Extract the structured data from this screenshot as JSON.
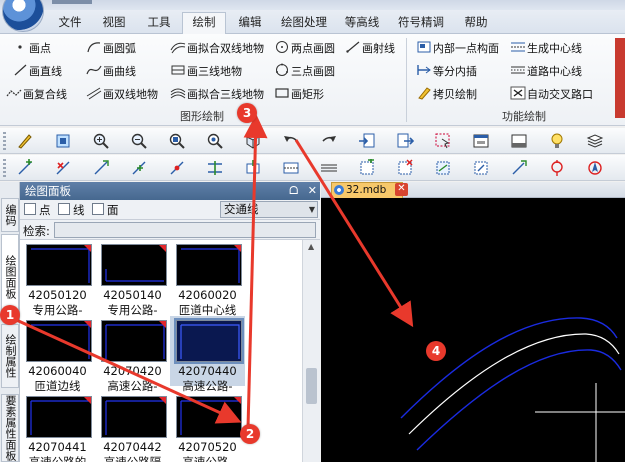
{
  "menu": {
    "items": [
      {
        "label": "文件"
      },
      {
        "label": "视图"
      },
      {
        "label": "工具"
      },
      {
        "label": "绘制"
      },
      {
        "label": "编辑"
      },
      {
        "label": "绘图处理"
      },
      {
        "label": "等高线"
      },
      {
        "label": "符号精调"
      },
      {
        "label": "帮助"
      }
    ],
    "active": "绘制"
  },
  "ribbon": {
    "drawing_group": {
      "title": "图形绘制",
      "items": [
        {
          "label": "画点",
          "icon": "point-icon"
        },
        {
          "label": "画直线",
          "icon": "line-icon"
        },
        {
          "label": "画复合线",
          "icon": "polyline-icon"
        },
        {
          "label": "画圆弧",
          "icon": "arc-icon"
        },
        {
          "label": "画曲线",
          "icon": "curve-icon"
        },
        {
          "label": "画双线地物",
          "icon": "double-line-icon"
        },
        {
          "label": "画拟合双线地物",
          "icon": "fit-double-line-icon"
        },
        {
          "label": "画三线地物",
          "icon": "triple-line-icon"
        },
        {
          "label": "画拟合三线地物",
          "icon": "fit-triple-line-icon"
        },
        {
          "label": "两点画圆",
          "icon": "circle-2pt-icon"
        },
        {
          "label": "三点画圆",
          "icon": "circle-3pt-icon"
        },
        {
          "label": "画矩形",
          "icon": "rectangle-icon"
        },
        {
          "label": "画射线",
          "icon": "ray-icon"
        }
      ]
    },
    "function_group": {
      "title": "功能绘制",
      "items": [
        {
          "label": "内部一点构面",
          "icon": "build-face-icon"
        },
        {
          "label": "等分内插",
          "icon": "interpolate-icon"
        },
        {
          "label": "拷贝绘制",
          "icon": "copy-draw-icon"
        },
        {
          "label": "生成中心线",
          "icon": "centerline-icon"
        },
        {
          "label": "道路中心线",
          "icon": "road-centerline-icon"
        },
        {
          "label": "自动交叉路口",
          "icon": "auto-intersection-icon"
        }
      ]
    }
  },
  "toolbar1": {
    "buttons": [
      "pencil-icon",
      "map-icon",
      "zoom-in-icon",
      "zoom-out-icon",
      "zoom-window-icon",
      "zoom-extent-icon",
      "cube-icon",
      "undo-icon",
      "redo-icon",
      "import-icon",
      "export-icon",
      "select-icon",
      "window-icon",
      "panel-icon",
      "light-icon",
      "stack-icon"
    ]
  },
  "toolbar2": {
    "buttons": [
      "add-node-icon",
      "delete-node-icon",
      "move-node-icon",
      "insert-node-icon",
      "pin-node-icon",
      "split-icon",
      "join-icon",
      "line-style-icon",
      "add-layer-icon",
      "delete-layer-icon",
      "swap-icon",
      "curve-edit-icon",
      "snap-icon",
      "compass-icon"
    ]
  },
  "side_tabs": [
    {
      "label": "编码表",
      "active": false
    },
    {
      "label": "绘图面板",
      "active": true
    },
    {
      "label": "绘制属性",
      "active": false
    },
    {
      "label": "要素属性面板",
      "active": false
    }
  ],
  "panel": {
    "title": "绘图面板",
    "header_buttons": [
      "ᗝ",
      "✕"
    ],
    "filters": [
      {
        "label": "点",
        "checked": false
      },
      {
        "label": "线",
        "checked": false
      },
      {
        "label": "面",
        "checked": false
      }
    ],
    "layer": "交通线",
    "search_label": "检索:",
    "search_value": "",
    "symbols": [
      {
        "code": "42050120",
        "name": "专用公路-"
      },
      {
        "code": "42050140",
        "name": "专用公路-"
      },
      {
        "code": "42060020",
        "name": "匝道中心线"
      },
      {
        "code": "42060040",
        "name": "匝道边线"
      },
      {
        "code": "42070420",
        "name": "高速公路-"
      },
      {
        "code": "42070440",
        "name": "高速公路-"
      },
      {
        "code": "42070441",
        "name": "高速公路的"
      },
      {
        "code": "42070442",
        "name": "高速公路隔"
      },
      {
        "code": "42070520",
        "name": "高速公路-"
      }
    ],
    "selected_index": 5
  },
  "document": {
    "tab_label": "32.mdb",
    "close": "✕"
  },
  "annotations": [
    {
      "label": "1"
    },
    {
      "label": "2"
    },
    {
      "label": "3"
    },
    {
      "label": "4"
    }
  ],
  "colors": {
    "accent_red": "#e8392c",
    "selection_blue": "#c9d6e6",
    "canvas_bg": "#000000",
    "road_edge": "#1a2be0",
    "road_center": "#ffffff"
  }
}
